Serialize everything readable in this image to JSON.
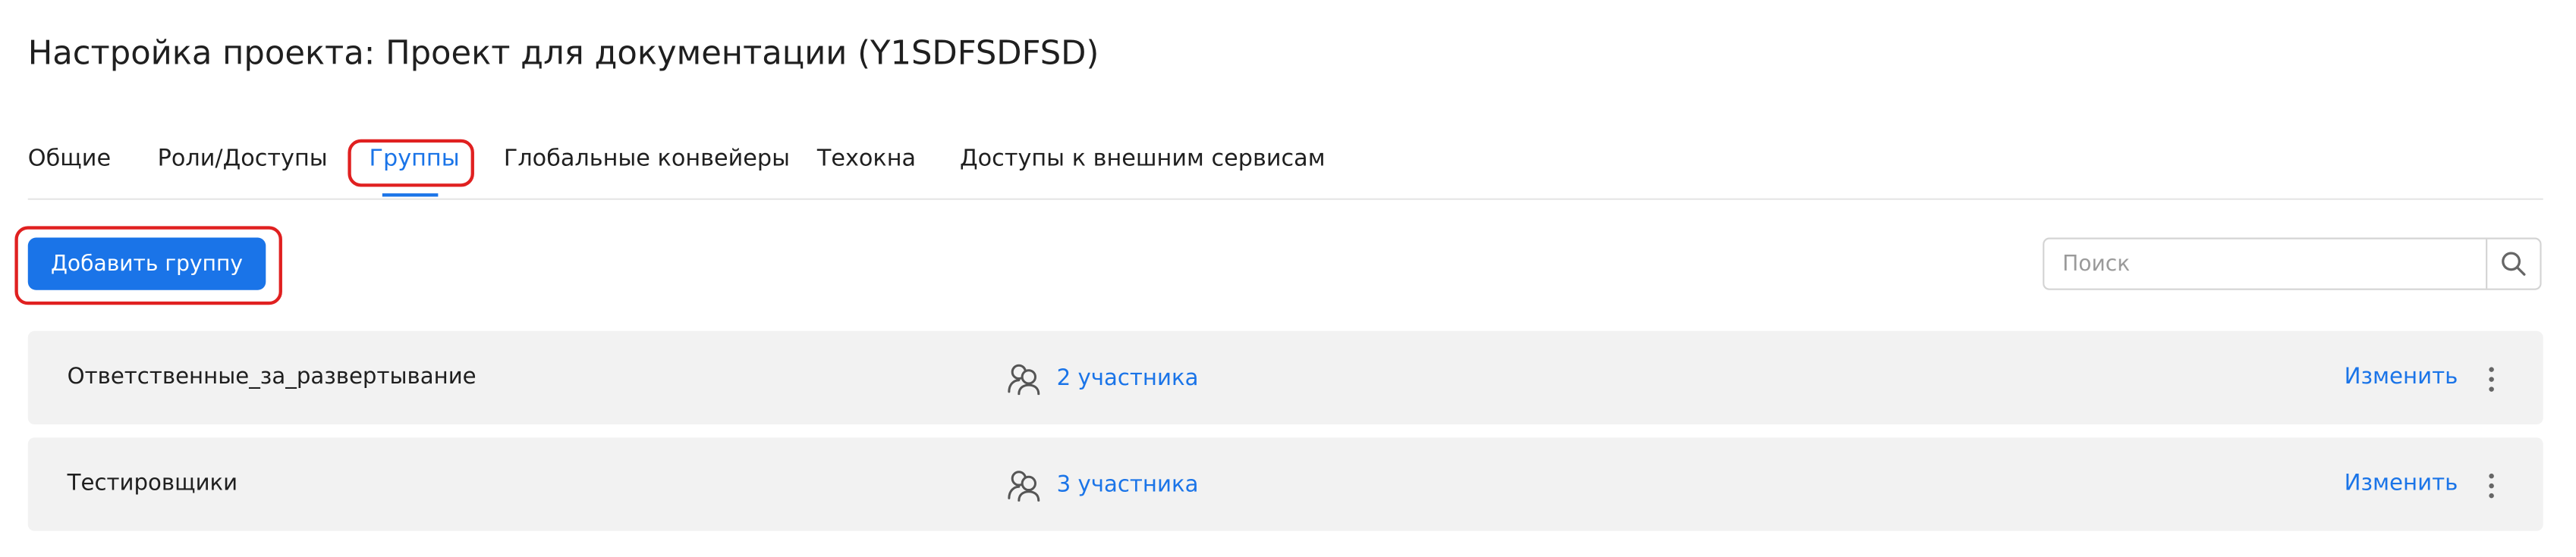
{
  "page": {
    "title": "Настройка проекта: Проект для документации (Y1SDFSDFSD)"
  },
  "tabs": [
    {
      "label": "Общие",
      "active": false
    },
    {
      "label": "Роли/Доступы",
      "active": false
    },
    {
      "label": "Группы",
      "active": true
    },
    {
      "label": "Глобальные конвейеры",
      "active": false
    },
    {
      "label": "Техокна",
      "active": false
    },
    {
      "label": "Доступы к внешним сервисам",
      "active": false
    }
  ],
  "toolbar": {
    "add_group_label": "Добавить группу",
    "search_placeholder": "Поиск",
    "search_value": "",
    "search_icon": "search-icon"
  },
  "groups": [
    {
      "name": "Ответственные_за_развертывание",
      "members_icon": "users-icon",
      "members_count": "2 участника",
      "edit_label": "Изменить",
      "more_icon": "more-vertical-icon"
    },
    {
      "name": "Тестировщики",
      "members_icon": "users-icon",
      "members_count": "3 участника",
      "edit_label": "Изменить",
      "more_icon": "more-vertical-icon"
    }
  ],
  "colors": {
    "accent": "#1a74e8",
    "highlight": "#e02020",
    "row_background": "#f2f2f2",
    "text": "#1f1f1f"
  }
}
